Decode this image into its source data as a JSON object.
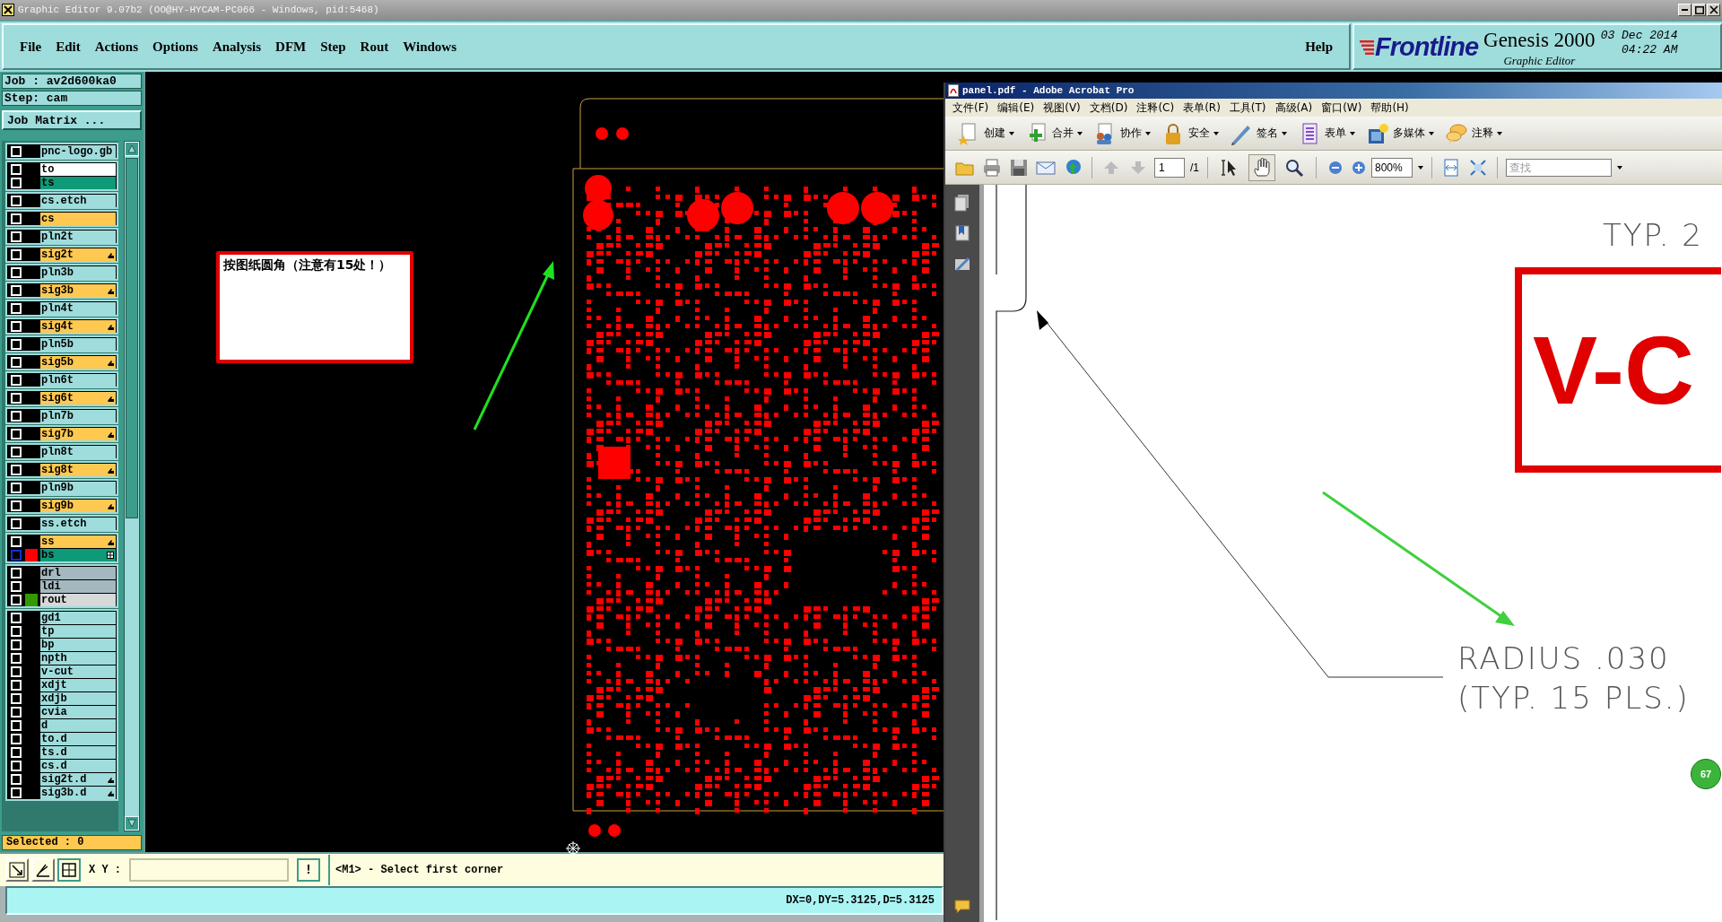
{
  "title_bar": {
    "title": "Graphic Editor 9.07b2 (OO@HY-HYCAM-PC066 - Windows, pid:5468)"
  },
  "menu": [
    "File",
    "Edit",
    "Actions",
    "Options",
    "Analysis",
    "DFM",
    "Step",
    "Rout",
    "Windows"
  ],
  "help": "Help",
  "logo": {
    "brand": "Frontline",
    "product": "Genesis 2000",
    "subtitle": "Graphic Editor",
    "date": "03 Dec 2014",
    "time": "04:22 AM"
  },
  "job": {
    "job": "Job : av2d600ka0",
    "step": "Step: cam",
    "matrix_button": "Job Matrix ..."
  },
  "layer_groups": [
    {
      "layers": [
        {
          "name": "pnc-logo.gb",
          "color": "#9fdcdc",
          "selected": false
        }
      ]
    },
    {
      "layers": [
        {
          "name": "to",
          "color": "#ffffff",
          "selected": false
        },
        {
          "name": "ts",
          "color": "#0e9a78",
          "selected": false
        }
      ]
    },
    {
      "layers": [
        {
          "name": "cs.etch",
          "color": "#9fdcdc",
          "selected": false
        }
      ]
    },
    {
      "layers": [
        {
          "name": "cs",
          "color": "#ffc850",
          "selected": false
        }
      ]
    },
    {
      "layers": [
        {
          "name": "pln2t",
          "color": "#9fdcdc",
          "selected": false
        }
      ]
    },
    {
      "layers": [
        {
          "name": "sig2t",
          "color": "#ffc850",
          "selected": false,
          "hand_mark": true
        }
      ]
    },
    {
      "layers": [
        {
          "name": "pln3b",
          "color": "#9fdcdc",
          "selected": false
        }
      ]
    },
    {
      "layers": [
        {
          "name": "sig3b",
          "color": "#ffc850",
          "selected": false,
          "hand_mark": true
        }
      ]
    },
    {
      "layers": [
        {
          "name": "pln4t",
          "color": "#9fdcdc",
          "selected": false
        }
      ]
    },
    {
      "layers": [
        {
          "name": "sig4t",
          "color": "#ffc850",
          "selected": false,
          "hand_mark": true
        }
      ]
    },
    {
      "layers": [
        {
          "name": "pln5b",
          "color": "#9fdcdc",
          "selected": false
        }
      ]
    },
    {
      "layers": [
        {
          "name": "sig5b",
          "color": "#ffc850",
          "selected": false,
          "hand_mark": true
        }
      ]
    },
    {
      "layers": [
        {
          "name": "pln6t",
          "color": "#9fdcdc",
          "selected": false
        }
      ]
    },
    {
      "layers": [
        {
          "name": "sig6t",
          "color": "#ffc850",
          "selected": false,
          "hand_mark": true
        }
      ]
    },
    {
      "layers": [
        {
          "name": "pln7b",
          "color": "#9fdcdc",
          "selected": false
        }
      ]
    },
    {
      "layers": [
        {
          "name": "sig7b",
          "color": "#ffc850",
          "selected": false,
          "hand_mark": true
        }
      ]
    },
    {
      "layers": [
        {
          "name": "pln8t",
          "color": "#9fdcdc",
          "selected": false
        }
      ]
    },
    {
      "layers": [
        {
          "name": "sig8t",
          "color": "#ffc850",
          "selected": false,
          "hand_mark": true
        }
      ]
    },
    {
      "layers": [
        {
          "name": "pln9b",
          "color": "#9fdcdc",
          "selected": false
        }
      ]
    },
    {
      "layers": [
        {
          "name": "sig9b",
          "color": "#ffc850",
          "selected": false,
          "hand_mark": true
        }
      ]
    },
    {
      "layers": [
        {
          "name": "ss.etch",
          "color": "#9fdcdc",
          "selected": false
        }
      ]
    },
    {
      "layers": [
        {
          "name": "ss",
          "color": "#ffc850",
          "selected": false,
          "hand_mark": true
        },
        {
          "name": "bs",
          "color": "#0e9a78",
          "selected": true,
          "swatch": {
            "color": "#ff0000"
          },
          "grid_mark": true
        }
      ]
    },
    {
      "layers": [
        {
          "name": "drl",
          "color": "#a4b8c0",
          "selected": false
        },
        {
          "name": "ldi",
          "color": "#a4b8c0",
          "selected": false
        },
        {
          "name": "rout",
          "color": "#d8d8d8",
          "selected": false,
          "swatch": {
            "color": "#339900"
          }
        }
      ]
    },
    {
      "layers": [
        {
          "name": "gd1",
          "color": "#9fdcdc",
          "selected": false
        },
        {
          "name": "tp",
          "color": "#9fdcdc",
          "selected": false
        },
        {
          "name": "bp",
          "color": "#9fdcdc",
          "selected": false
        },
        {
          "name": "npth",
          "color": "#9fdcdc",
          "selected": false
        },
        {
          "name": "v-cut",
          "color": "#9fdcdc",
          "selected": false
        },
        {
          "name": "xdjt",
          "color": "#9fdcdc",
          "selected": false
        },
        {
          "name": "xdjb",
          "color": "#9fdcdc",
          "selected": false
        },
        {
          "name": "cvia",
          "color": "#9fdcdc",
          "selected": false
        },
        {
          "name": "d",
          "color": "#9fdcdc",
          "selected": false
        },
        {
          "name": "to.d",
          "color": "#9fdcdc",
          "selected": false
        },
        {
          "name": "ts.d",
          "color": "#9fdcdc",
          "selected": false
        },
        {
          "name": "cs.d",
          "color": "#9fdcdc",
          "selected": false
        },
        {
          "name": "sig2t.d",
          "color": "#9fdcdc",
          "selected": false,
          "hand_mark": true
        },
        {
          "name": "sig3b.d",
          "color": "#9fdcdc",
          "selected": false,
          "hand_mark": true
        }
      ]
    }
  ],
  "selected_count": "Selected : 0",
  "note": {
    "text": "按图纸圆角（注意有15处！）"
  },
  "command_bar": {
    "xy_label": "X Y :",
    "alert": "!",
    "prompt": "<M1> - Select first corner"
  },
  "status": "DX=0,DY=5.3125,D=5.3125",
  "acrobat": {
    "title": "panel.pdf - Adobe Acrobat Pro",
    "menu": [
      "文件(F)",
      "编辑(E)",
      "视图(V)",
      "文档(D)",
      "注释(C)",
      "表单(R)",
      "工具(T)",
      "高级(A)",
      "窗口(W)",
      "帮助(H)"
    ],
    "tasks": [
      "创建",
      "合并",
      "协作",
      "安全",
      "签名",
      "表单",
      "多媒体",
      "注释"
    ],
    "page_number": "1",
    "page_total": "/1",
    "tools": [
      {
        "kind": "select",
        "selected": false
      },
      {
        "kind": "hand",
        "selected": true
      },
      {
        "kind": "zoom",
        "selected": false
      }
    ],
    "zoom": "800%",
    "search": {
      "placeholder": "查找"
    },
    "page": {
      "typ_label": "TYP. 2",
      "box_text": "V-C",
      "radius": "RADIUS .030",
      "radius_note": "(TYP. 15 PLS.)",
      "badge": "67"
    }
  }
}
